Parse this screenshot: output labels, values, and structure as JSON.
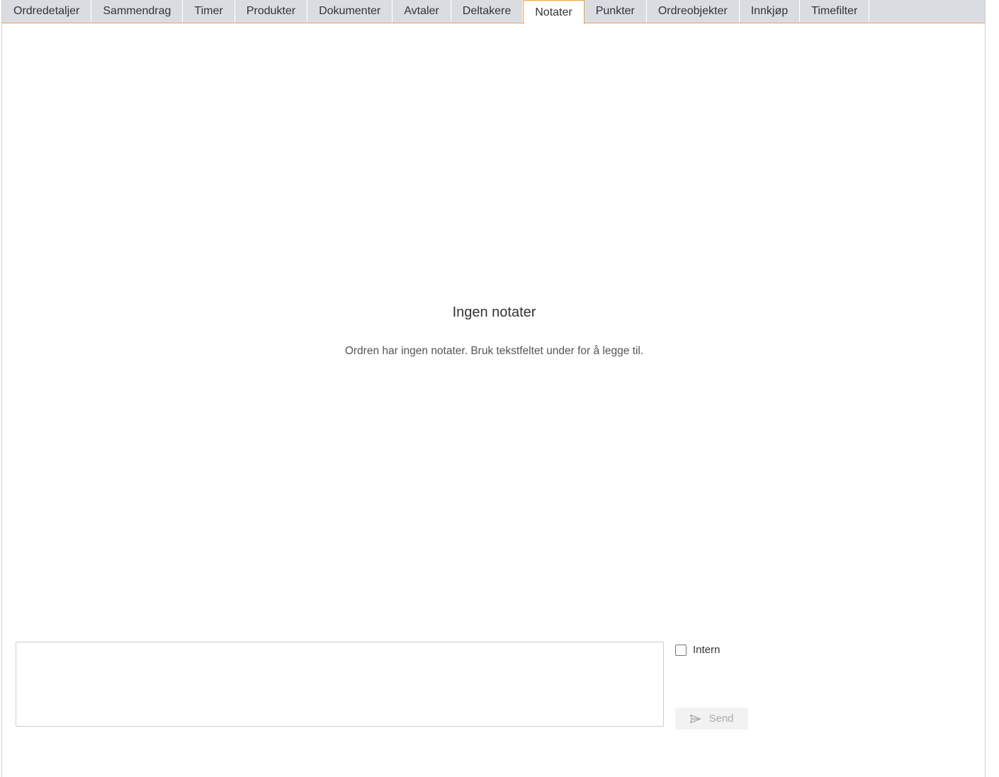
{
  "tabs": [
    {
      "label": "Ordredetaljer"
    },
    {
      "label": "Sammendrag"
    },
    {
      "label": "Timer"
    },
    {
      "label": "Produkter"
    },
    {
      "label": "Dokumenter"
    },
    {
      "label": "Avtaler"
    },
    {
      "label": "Deltakere"
    },
    {
      "label": "Notater"
    },
    {
      "label": "Punkter"
    },
    {
      "label": "Ordreobjekter"
    },
    {
      "label": "Innkjøp"
    },
    {
      "label": "Timefilter"
    }
  ],
  "active_tab": "Notater",
  "empty_state": {
    "title": "Ingen notater",
    "text": "Ordren har ingen notater. Bruk tekstfeltet under for å legge til."
  },
  "composer": {
    "text_value": "",
    "intern_label": "Intern",
    "intern_checked": false,
    "send_label": "Send",
    "send_icon": "send-icon"
  },
  "colors": {
    "accent": "#f0a040",
    "tabbar_bg": "#d9dde2"
  }
}
